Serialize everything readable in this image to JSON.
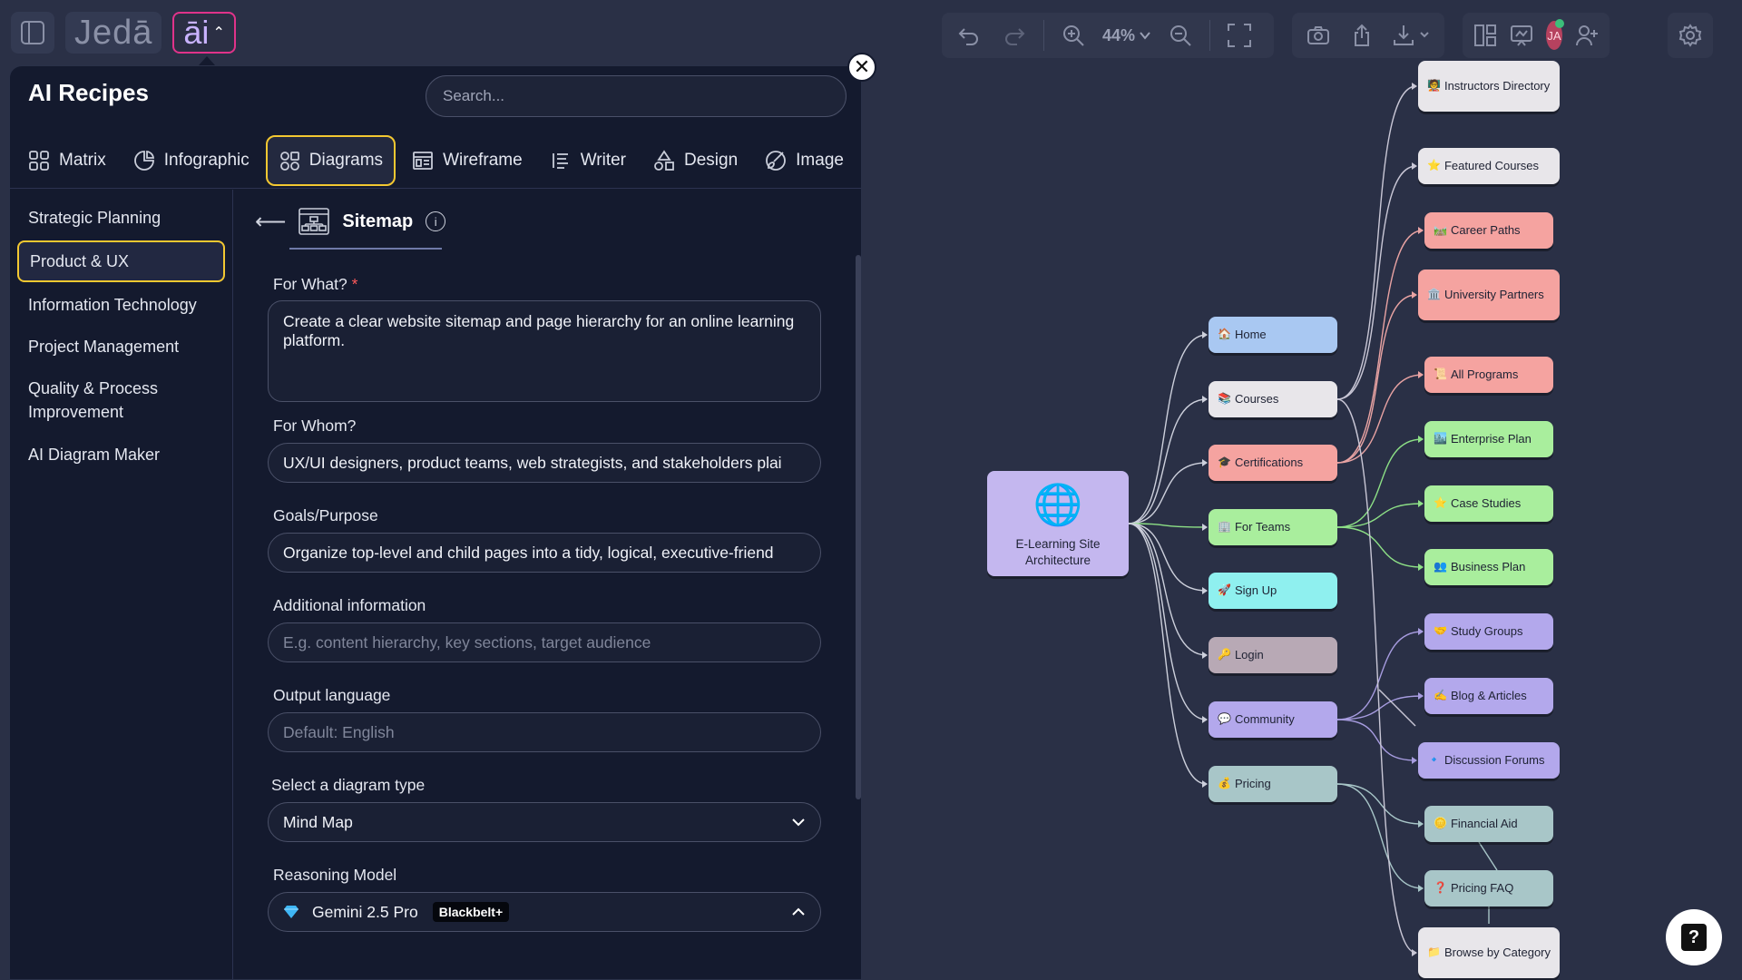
{
  "app": {
    "logo": "Jedā",
    "ai_label": "āi"
  },
  "toolbar": {
    "zoom": "44%",
    "avatar_initials": "JA"
  },
  "panel": {
    "title": "AI Recipes",
    "search_placeholder": "Search...",
    "close": "✕",
    "tabs": [
      {
        "label": "Matrix",
        "icon": "grid-icon"
      },
      {
        "label": "Infographic",
        "icon": "pie-icon"
      },
      {
        "label": "Diagrams",
        "icon": "diagram-icon",
        "active": true
      },
      {
        "label": "Wireframe",
        "icon": "wireframe-icon"
      },
      {
        "label": "Writer",
        "icon": "list-icon"
      },
      {
        "label": "Design",
        "icon": "shapes-icon"
      },
      {
        "label": "Image",
        "icon": "brush-icon"
      }
    ],
    "categories": [
      "Strategic Planning",
      "Product & UX",
      "Information Technology",
      "Project Management",
      "Quality & Process Improvement",
      "AI Diagram Maker"
    ],
    "active_category": "Product & UX"
  },
  "recipe": {
    "back": "⟵",
    "name": "Sitemap",
    "info": "i",
    "for_what_label": "For What?",
    "required_mark": "*",
    "for_what_value": "Create a clear website sitemap and page hierarchy for an online learning platform.",
    "for_whom_label": "For Whom?",
    "for_whom_value": "UX/UI designers, product teams, web strategists, and stakeholders plai",
    "goals_label": "Goals/Purpose",
    "goals_value": "Organize top-level and child pages into a tidy, logical, executive-friend",
    "additional_label": "Additional information",
    "additional_placeholder": "E.g. content hierarchy, key sections, target audience",
    "language_label": "Output language",
    "language_placeholder": "Default: English",
    "diagram_type_label": "Select a diagram type",
    "diagram_type_value": "Mind Map",
    "model_label": "Reasoning Model",
    "model_value": "Gemini 2.5 Pro",
    "model_badge": "Blackbelt+"
  },
  "mindmap": {
    "root": {
      "label": "E-Learning Site Architecture",
      "icon": "🌐"
    },
    "level1": [
      {
        "label": "Home",
        "emoji": "🏠",
        "color": "#a9c8f2"
      },
      {
        "label": "Courses",
        "emoji": "📚",
        "color": "#e8e6ea"
      },
      {
        "label": "Certifications",
        "emoji": "🎓",
        "color": "#f5a3a0"
      },
      {
        "label": "For Teams",
        "emoji": "🏢",
        "color": "#a9ee9d"
      },
      {
        "label": "Sign Up",
        "emoji": "🚀",
        "color": "#8ff0ef"
      },
      {
        "label": "Login",
        "emoji": "🔑",
        "color": "#b8a9b5"
      },
      {
        "label": "Community",
        "emoji": "💬",
        "color": "#b3a8ec"
      },
      {
        "label": "Pricing",
        "emoji": "💰",
        "color": "#a8c6c8"
      }
    ],
    "level2": [
      {
        "label": "Instructors Directory",
        "emoji": "🧑‍🏫",
        "color": "#e8e6ea"
      },
      {
        "label": "Featured Courses",
        "emoji": "⭐",
        "color": "#e8e6ea"
      },
      {
        "label": "Career Paths",
        "emoji": "🛤️",
        "color": "#f5a3a0"
      },
      {
        "label": "University Partners",
        "emoji": "🏛️",
        "color": "#f5a3a0"
      },
      {
        "label": "All Programs",
        "emoji": "📜",
        "color": "#f5a3a0"
      },
      {
        "label": "Enterprise Plan",
        "emoji": "🏙️",
        "color": "#a9ee9d"
      },
      {
        "label": "Case Studies",
        "emoji": "⭐",
        "color": "#a9ee9d"
      },
      {
        "label": "Business Plan",
        "emoji": "👥",
        "color": "#a9ee9d"
      },
      {
        "label": "Study Groups",
        "emoji": "🤝",
        "color": "#b3a8ec"
      },
      {
        "label": "Blog & Articles",
        "emoji": "✍️",
        "color": "#b3a8ec"
      },
      {
        "label": "Discussion Forums",
        "emoji": "🔹",
        "color": "#b3a8ec"
      },
      {
        "label": "Financial Aid",
        "emoji": "🪙",
        "color": "#a8c6c8"
      },
      {
        "label": "Pricing FAQ",
        "emoji": "❓",
        "color": "#a8c6c8"
      },
      {
        "label": "Browse by Category",
        "emoji": "📁",
        "color": "#e8e6ea"
      }
    ]
  },
  "help": {
    "label": "?"
  }
}
